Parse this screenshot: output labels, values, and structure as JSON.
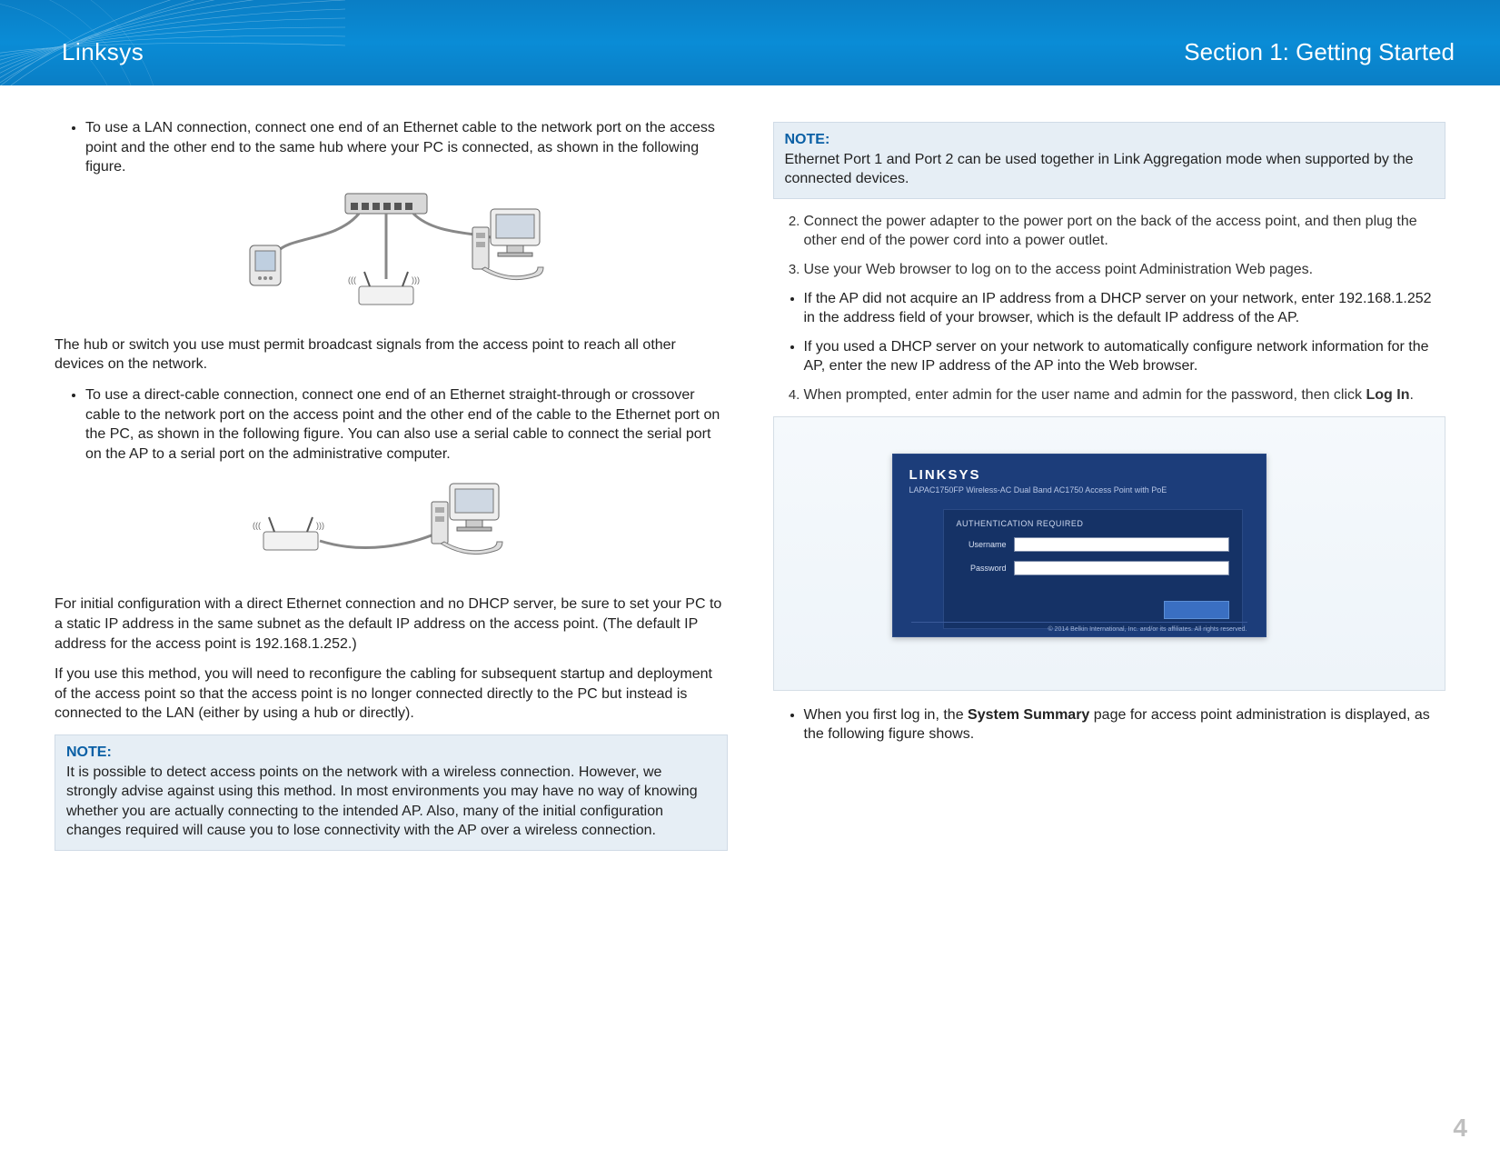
{
  "header": {
    "brand": "Linksys",
    "section": "Section 1:  Getting Started"
  },
  "left": {
    "bullet_lan": "To use a LAN connection, connect one end of an Ethernet cable to the network port on the access point and the other end to the same hub where your PC is connected, as shown in the following figure.",
    "hub_text": "The hub or switch you use must permit broadcast signals from the access point to reach all other devices on the network.",
    "bullet_direct": "To use a direct-cable connection, connect one end of an Ethernet straight-through or crossover cable to the network port on the access point and the other end of the cable to the Ethernet port on the PC, as shown in the following figure. You can also use a serial cable to connect the serial port on the AP to a serial port on the administrative computer.",
    "para_initial": "For initial configuration with a direct Ethernet connection and no DHCP server, be sure to set your PC to a static IP address in the same subnet as the default IP address on the access point. (The default IP address for the access point is 192.168.1.252.)",
    "para_reconfig": "If you use this method, you will need to reconfigure the cabling for subsequent startup and deployment of the access point so that the access point is no longer connected directly to the PC but instead is connected to the LAN (either by using a hub or directly).",
    "note_title": "NOTE:",
    "note_body": "It is possible to detect access points on the network with a wireless connection. However, we strongly advise against using this method. In most environments you may have no way of knowing whether you are actually connecting to the intended AP. Also, many of the initial configuration changes required will cause you to lose connectivity with the AP over a wireless connection."
  },
  "right": {
    "note_title": "NOTE:",
    "note_body": "Ethernet Port 1 and Port 2 can be used together in Link Aggregation mode when supported by the connected devices.",
    "step2": "Connect the power adapter to the power port on the back of the access point, and then plug the other end of the power cord into a power outlet.",
    "step3": "Use your Web browser to log on to the access point Administration Web pages.",
    "bullet_no_dhcp": "If the AP did not acquire an IP address from a DHCP server on your network, enter 192.168.1.252 in the address field of your browser, which is the default IP address of the AP.",
    "bullet_dhcp": "If you used a DHCP server on your network to automatically configure network information for the AP, enter the new IP address of the AP into the Web browser.",
    "step4_a": "When prompted, enter admin for the user name and admin for the password, then click ",
    "step4_b": "Log In",
    "step4_c": ".",
    "login": {
      "brand": "LINKSYS",
      "model": "LAPAC1750FP Wireless-AC Dual Band AC1750 Access Point with PoE",
      "panel_title": "AUTHENTICATION REQUIRED",
      "username_label": "Username",
      "password_label": "Password",
      "footer": "© 2014 Belkin International, Inc. and/or its affiliates. All rights reserved."
    },
    "bullet_summary_a": "When you first log in, the ",
    "bullet_summary_b": "System Summary",
    "bullet_summary_c": " page for access point administration is displayed, as the following figure shows."
  },
  "page_number": "4"
}
